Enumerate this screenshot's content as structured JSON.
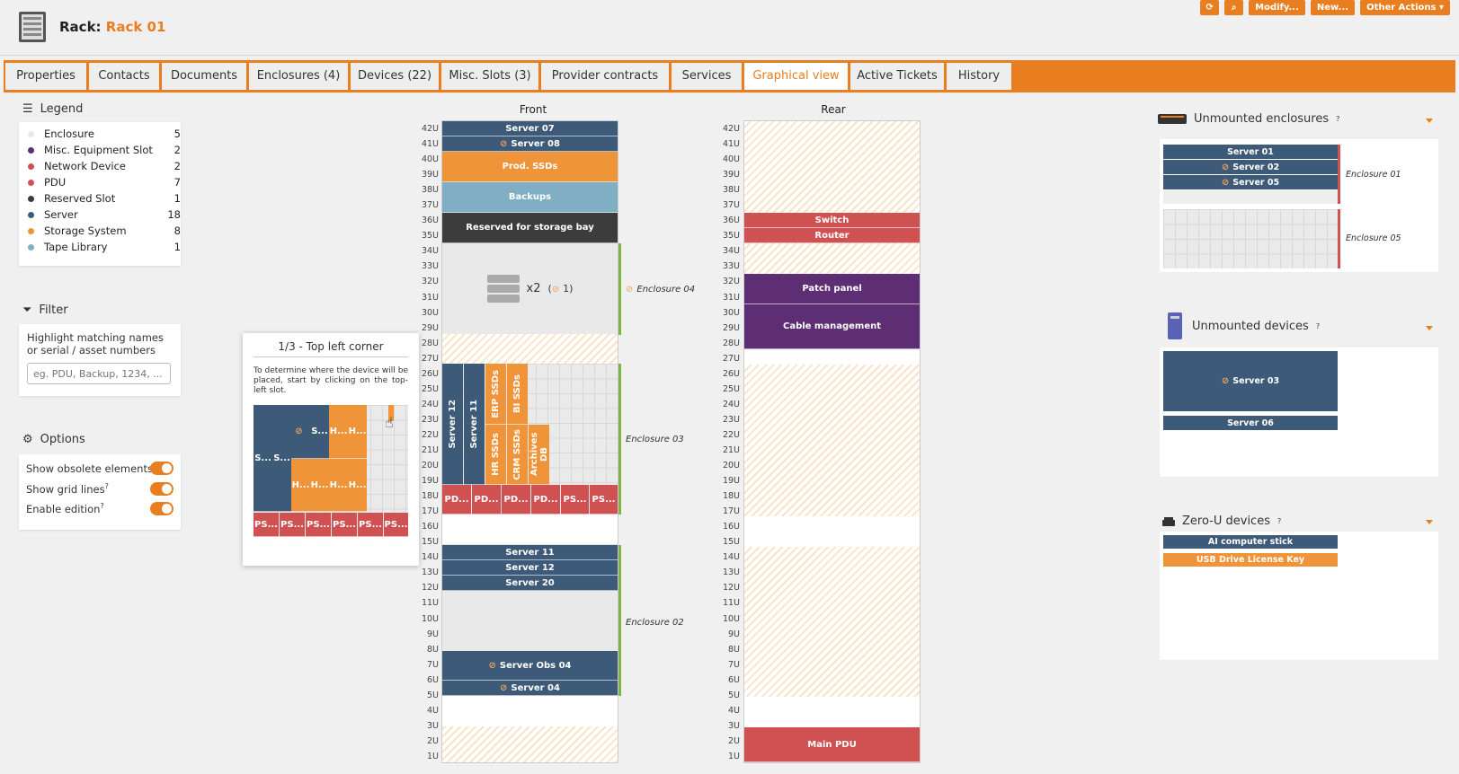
{
  "header": {
    "rack_label": "Rack:",
    "rack_name": "Rack 01",
    "actions": {
      "modify": "Modify...",
      "new": "New...",
      "other": "Other Actions"
    }
  },
  "tabs": [
    {
      "label": "Properties"
    },
    {
      "label": "Contacts"
    },
    {
      "label": "Documents"
    },
    {
      "label": "Enclosures (4)"
    },
    {
      "label": "Devices (22)"
    },
    {
      "label": "Misc. Slots (3)"
    },
    {
      "label": "Provider contracts"
    },
    {
      "label": "Services"
    },
    {
      "label": "Graphical view"
    },
    {
      "label": "Active Tickets"
    },
    {
      "label": "History"
    }
  ],
  "legend": {
    "title": "Legend",
    "items": [
      {
        "label": "Enclosure",
        "count": "5",
        "color": "#e8e8e8"
      },
      {
        "label": "Misc. Equipment Slot",
        "count": "2",
        "color": "#5d2e73"
      },
      {
        "label": "Network Device",
        "count": "2",
        "color": "#d05151"
      },
      {
        "label": "PDU",
        "count": "7",
        "color": "#d05151"
      },
      {
        "label": "Reserved Slot",
        "count": "1",
        "color": "#3c3c3c"
      },
      {
        "label": "Server",
        "count": "18",
        "color": "#3d5a78"
      },
      {
        "label": "Storage System",
        "count": "8",
        "color": "#ef9438"
      },
      {
        "label": "Tape Library",
        "count": "1",
        "color": "#7faec5"
      }
    ]
  },
  "filter": {
    "title": "Filter",
    "help": "Highlight matching names or serial / asset numbers",
    "placeholder": "eg. PDU, Backup, 1234, ..."
  },
  "options": {
    "title": "Options",
    "obsolete": "Show obsolete elements",
    "grid": "Show grid lines",
    "edition": "Enable edition"
  },
  "tooltip": {
    "title": "1/3 - Top left corner",
    "text": "To determine where the device will be placed, start by clicking on the top-left slot.",
    "s": "S...",
    "h": "H...",
    "ps": "PS..."
  },
  "front": {
    "title": "Front",
    "devices": {
      "server07": "Server 07",
      "server08": "Server 08",
      "prodssds": "Prod. SSDs",
      "backups": "Backups",
      "reserved": "Reserved for storage bay",
      "enc04_count": "x2",
      "enc04_obsolete": "1",
      "server12a": "Server 12",
      "server11a": "Server 11",
      "erp": "ERP SSDs",
      "bi": "BI SSDs",
      "hr": "HR SSDs",
      "crm": "CRM SSDs",
      "archives": "Archives DB",
      "pd": "PD...",
      "ps": "PS...",
      "server11": "Server 11",
      "server12": "Server 12",
      "server20": "Server 20",
      "obs04": "Server Obs 04",
      "server04": "Server 04"
    },
    "enclosures": {
      "e04": "Enclosure 04",
      "e03": "Enclosure 03",
      "e02": "Enclosure 02"
    }
  },
  "rear": {
    "title": "Rear",
    "devices": {
      "switch": "Switch",
      "router": "Router",
      "patch": "Patch panel",
      "cable": "Cable management",
      "pdu": "Main PDU"
    }
  },
  "units": [
    "42U",
    "41U",
    "40U",
    "39U",
    "38U",
    "37U",
    "36U",
    "35U",
    "34U",
    "33U",
    "32U",
    "31U",
    "30U",
    "29U",
    "28U",
    "27U",
    "26U",
    "25U",
    "24U",
    "23U",
    "22U",
    "21U",
    "20U",
    "19U",
    "18U",
    "17U",
    "16U",
    "15U",
    "14U",
    "13U",
    "12U",
    "11U",
    "10U",
    "9U",
    "8U",
    "7U",
    "6U",
    "5U",
    "4U",
    "3U",
    "2U",
    "1U"
  ],
  "unmounted_enclosures": {
    "title": "Unmounted enclosures",
    "enc01": "Enclosure 01",
    "enc05": "Enclosure 05",
    "s01": "Server 01",
    "s02": "Server 02",
    "s05": "Server 05"
  },
  "unmounted_devices": {
    "title": "Unmounted devices",
    "s03": "Server 03",
    "s06": "Server 06"
  },
  "zero_u": {
    "title": "Zero-U devices",
    "ai": "AI computer stick",
    "usb": "USB Drive License Key"
  }
}
